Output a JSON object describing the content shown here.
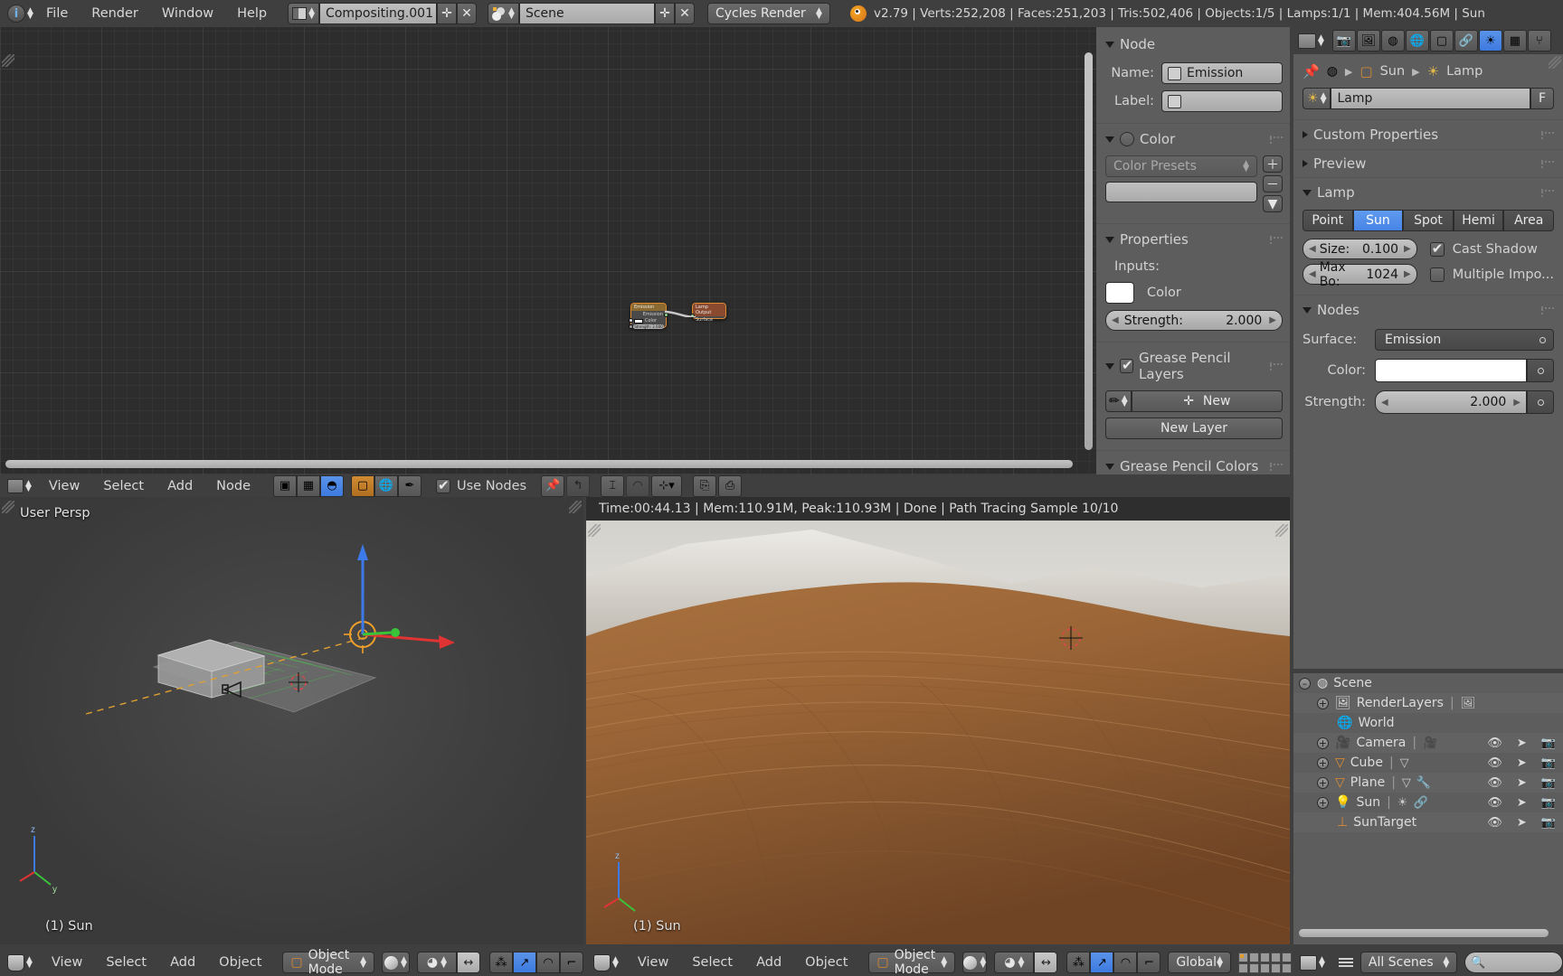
{
  "topbar": {
    "menus": [
      "File",
      "Render",
      "Window",
      "Help"
    ],
    "screen_layout": "Compositing.001",
    "scene": "Scene",
    "engine": "Cycles Render",
    "stats": "v2.79 | Verts:252,208 | Faces:251,203 | Tris:502,406 | Objects:1/5 | Lamps:1/1 | Mem:404.56M | Sun"
  },
  "node_editor": {
    "label": "Lamp",
    "header": {
      "menus": [
        "View",
        "Select",
        "Add",
        "Node"
      ],
      "use_nodes_label": "Use Nodes",
      "use_nodes_checked": true
    },
    "nodes": [
      {
        "title": "Emission",
        "rows": [
          "Emission",
          "Color",
          "Strength: 2.000"
        ]
      },
      {
        "title": "Lamp Output",
        "rows": [
          "Surface"
        ]
      }
    ]
  },
  "node_props": {
    "node_panel": {
      "title": "Node",
      "name_label": "Name:",
      "name_value": "Emission",
      "label_label": "Label:",
      "label_value": ""
    },
    "color_panel": {
      "title": "Color",
      "enabled": false,
      "presets_placeholder": "Color Presets"
    },
    "properties_panel": {
      "title": "Properties",
      "inputs_label": "Inputs:",
      "color_label": "Color",
      "color_value": "#ffffff",
      "strength_label": "Strength:",
      "strength_value": "2.000"
    },
    "grease_pencil_layers": {
      "title": "Grease Pencil Layers",
      "checked": true,
      "new_label": "New",
      "new_layer_label": "New Layer"
    },
    "grease_pencil_colors": {
      "title": "Grease Pencil Colors"
    }
  },
  "properties_editor": {
    "breadcrumb": [
      {
        "icon": "object-icon",
        "label": "Sun"
      },
      {
        "icon": "lamp-icon",
        "label": "Lamp"
      }
    ],
    "datablock": {
      "name": "Lamp",
      "fake_user_label": "F"
    },
    "panels": {
      "custom_properties": "Custom Properties",
      "preview": "Preview",
      "lamp": "Lamp",
      "nodes": "Nodes"
    },
    "lamp_types": [
      "Point",
      "Sun",
      "Spot",
      "Hemi",
      "Area"
    ],
    "lamp_type_active": "Sun",
    "size_label": "Size:",
    "size_value": "0.100",
    "maxbo_label": "Max Bo:",
    "maxbo_value": "1024",
    "cast_shadow_label": "Cast Shadow",
    "cast_shadow_checked": true,
    "multiple_importance_label": "Multiple Impo...",
    "multiple_importance_checked": false,
    "surface_label": "Surface:",
    "surface_value": "Emission",
    "color_label": "Color:",
    "color_value": "#ffffff",
    "strength_label": "Strength:",
    "strength_value": "2.000"
  },
  "outliner": {
    "display_mode": "All Scenes",
    "rows": [
      {
        "label": "Scene",
        "indent": 0,
        "icon": "scene-icon",
        "expander": "collapse",
        "extra": [],
        "toggles": false
      },
      {
        "label": "RenderLayers",
        "indent": 1,
        "icon": "renderlayers-icon",
        "expander": "expand",
        "extra": [
          "renderlayers-data-icon"
        ],
        "toggles": false
      },
      {
        "label": "World",
        "indent": 1,
        "icon": "world-icon",
        "expander": "none",
        "extra": [],
        "toggles": false
      },
      {
        "label": "Camera",
        "indent": 1,
        "icon": "camera-icon",
        "expander": "expand",
        "extra": [
          "camera-data-icon"
        ],
        "toggles": true
      },
      {
        "label": "Cube",
        "indent": 1,
        "icon": "mesh-icon",
        "expander": "expand",
        "extra": [
          "mesh-data-icon"
        ],
        "toggles": true
      },
      {
        "label": "Plane",
        "indent": 1,
        "icon": "mesh-icon",
        "expander": "expand",
        "extra": [
          "mesh-data-icon",
          "modifier-icon"
        ],
        "toggles": true
      },
      {
        "label": "Sun",
        "indent": 1,
        "icon": "lamp-obj-icon",
        "expander": "expand",
        "extra": [
          "lamp-data-icon",
          "link-icon"
        ],
        "toggles": true
      },
      {
        "label": "SunTarget",
        "indent": 1,
        "icon": "empty-icon",
        "expander": "none",
        "extra": [],
        "toggles": true
      }
    ]
  },
  "viewport_left": {
    "view_name": "User Persp",
    "active_object": "(1) Sun",
    "header": {
      "menus": [
        "View",
        "Select",
        "Add",
        "Object"
      ],
      "mode": "Object Mode"
    }
  },
  "viewport_right": {
    "render_status": "Time:00:44.13 | Mem:110.91M, Peak:110.93M | Done | Path Tracing Sample 10/10",
    "active_object": "(1) Sun",
    "header": {
      "menus": [
        "View",
        "Select",
        "Add",
        "Object"
      ],
      "mode": "Object Mode",
      "orientation": "Global"
    }
  },
  "colors": {
    "accent_blue": "#3d7ae0",
    "node_orange": "#e08a2e",
    "panel_bg": "#5d5d5d",
    "header_bg": "#3f3f3f",
    "editor_bg": "#2d2d2d"
  }
}
